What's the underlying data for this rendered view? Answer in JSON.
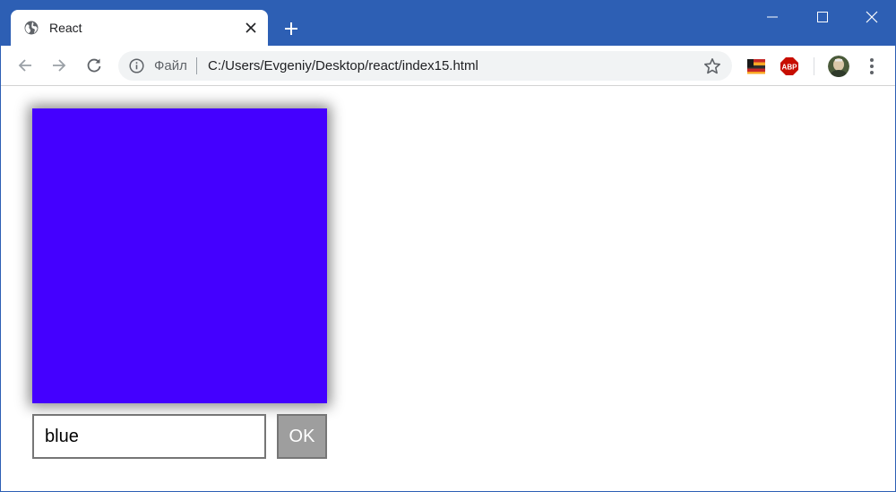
{
  "browser": {
    "tab": {
      "title": "React",
      "favicon": "globe-icon"
    },
    "window_buttons": [
      "minimize-icon",
      "maximize-icon",
      "close-icon"
    ],
    "omnibox": {
      "origin_chip": "Файл",
      "url": "C:/Users/Evgeniy/Desktop/react/index15.html"
    },
    "extensions": [
      "flag-extension-icon",
      "adblock-plus-icon"
    ],
    "adblock_label": "ABP",
    "colors": {
      "frame": "#2d5fb4",
      "toolbar": "#ffffff",
      "omnibox": "#f1f3f4"
    }
  },
  "app": {
    "color_box": {
      "color": "#4400ff"
    },
    "color_input": {
      "value": "blue"
    },
    "ok_button": {
      "label": "OK",
      "background": "#9e9e9e"
    }
  }
}
